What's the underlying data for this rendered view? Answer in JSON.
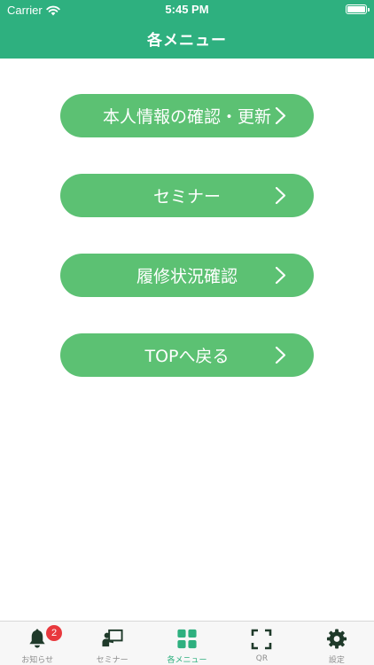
{
  "status_bar": {
    "carrier": "Carrier",
    "time": "5:45 PM"
  },
  "header": {
    "title": "各メニュー"
  },
  "menu": {
    "items": [
      {
        "label": "本人情報の確認・更新"
      },
      {
        "label": "セミナー"
      },
      {
        "label": "履修状況確認"
      },
      {
        "label": "TOPへ戻る"
      }
    ]
  },
  "tabbar": {
    "items": [
      {
        "label": "お知らせ",
        "icon": "bell-icon",
        "badge": "2"
      },
      {
        "label": "セミナー",
        "icon": "seminar-icon"
      },
      {
        "label": "各メニュー",
        "icon": "grid-icon"
      },
      {
        "label": "QR",
        "icon": "qr-scan-icon"
      },
      {
        "label": "設定",
        "icon": "gear-icon"
      }
    ]
  },
  "colors": {
    "header_bg": "#2eb07f",
    "button_bg": "#5cc173",
    "tab_active": "#2eb07f",
    "tab_inactive": "#1f3a2a",
    "badge": "#e8383d"
  }
}
